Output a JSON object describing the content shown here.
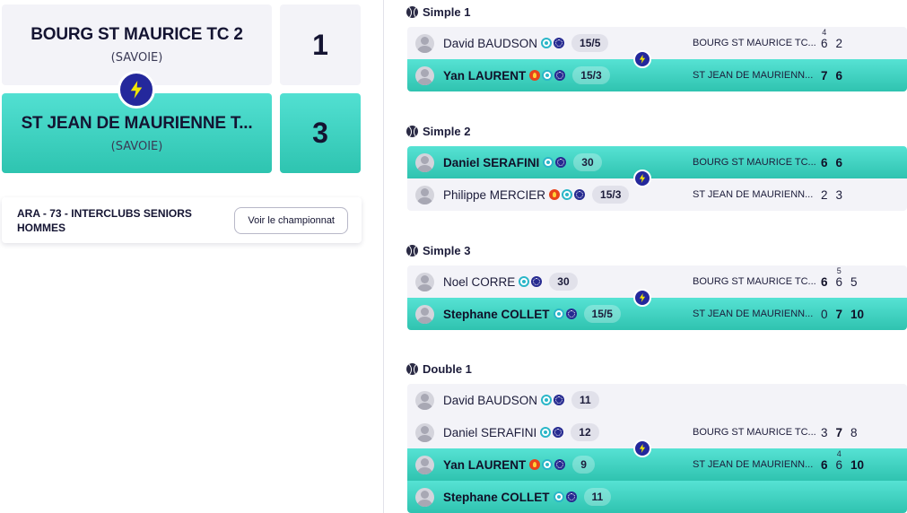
{
  "header": {
    "team1": {
      "name": "BOURG ST MAURICE TC 2",
      "region": "(SAVOIE)",
      "score": "1"
    },
    "team2": {
      "name": "ST JEAN DE MAURIENNE T...",
      "region": "(SAVOIE)",
      "score": "3"
    }
  },
  "championship": {
    "title": "ARA - 73 - INTERCLUBS SENIORS HOMMES",
    "button_label": "Voir le championnat"
  },
  "colors": {
    "winner": "#2fc3b0",
    "loser": "#f3f3f8",
    "accent": "#24289c",
    "text": "#1c1c3a"
  },
  "icons": {
    "vs": "lightning-bolt-icon",
    "match_type": "tennis-ball-icon",
    "player": "avatar-placeholder-icon"
  },
  "matches": [
    {
      "title": "Simple 1",
      "players": [
        {
          "name": "David BAUDSON",
          "rank": "15/5",
          "badges": [
            "teal",
            "blue"
          ]
        },
        {
          "name": "Yan LAURENT",
          "rank": "15/3",
          "badges": [
            "fire",
            "teal",
            "blue"
          ]
        }
      ],
      "teams": [
        {
          "club": "BOURG ST MAURICE TC...",
          "sets": [
            {
              "v": "6",
              "tb": "4"
            },
            {
              "v": "2"
            }
          ]
        },
        {
          "club": "ST JEAN DE MAURIENN...",
          "sets": [
            {
              "v": "7"
            },
            {
              "v": "6"
            }
          ]
        }
      ]
    },
    {
      "title": "Simple 2",
      "players": [
        {
          "name": "Daniel SERAFINI",
          "rank": "30",
          "badges": [
            "teal",
            "blue"
          ]
        },
        {
          "name": "Philippe MERCIER",
          "rank": "15/3",
          "badges": [
            "fire",
            "teal",
            "blue"
          ]
        }
      ],
      "teams": [
        {
          "club": "BOURG ST MAURICE TC...",
          "sets": [
            {
              "v": "6"
            },
            {
              "v": "6"
            }
          ]
        },
        {
          "club": "ST JEAN DE MAURIENN...",
          "sets": [
            {
              "v": "2"
            },
            {
              "v": "3"
            }
          ]
        }
      ]
    },
    {
      "title": "Simple 3",
      "players": [
        {
          "name": "Noel CORRE",
          "rank": "30",
          "badges": [
            "teal",
            "blue"
          ]
        },
        {
          "name": "Stephane COLLET",
          "rank": "15/5",
          "badges": [
            "teal",
            "blue"
          ]
        }
      ],
      "teams": [
        {
          "club": "BOURG ST MAURICE TC...",
          "sets": [
            {
              "v": "6"
            },
            {
              "v": "6",
              "tb": "5"
            },
            {
              "v": "5"
            }
          ]
        },
        {
          "club": "ST JEAN DE MAURIENN...",
          "sets": [
            {
              "v": "0"
            },
            {
              "v": "7"
            },
            {
              "v": "10"
            }
          ]
        }
      ]
    },
    {
      "title": "Double 1",
      "players": [
        {
          "name": "David BAUDSON",
          "rank": "11",
          "badges": [
            "teal",
            "blue"
          ]
        },
        {
          "name": "Daniel SERAFINI",
          "rank": "12",
          "badges": [
            "teal",
            "blue"
          ]
        },
        {
          "name": "Yan LAURENT",
          "rank": "9",
          "badges": [
            "fire",
            "teal",
            "blue"
          ]
        },
        {
          "name": "Stephane COLLET",
          "rank": "11",
          "badges": [
            "teal",
            "blue"
          ]
        }
      ],
      "teams": [
        {
          "club": "BOURG ST MAURICE TC...",
          "sets": [
            {
              "v": "3"
            },
            {
              "v": "7"
            },
            {
              "v": "8"
            }
          ]
        },
        {
          "club": "ST JEAN DE MAURIENN...",
          "sets": [
            {
              "v": "6"
            },
            {
              "v": "6",
              "tb": "4"
            },
            {
              "v": "10"
            }
          ]
        }
      ]
    }
  ]
}
